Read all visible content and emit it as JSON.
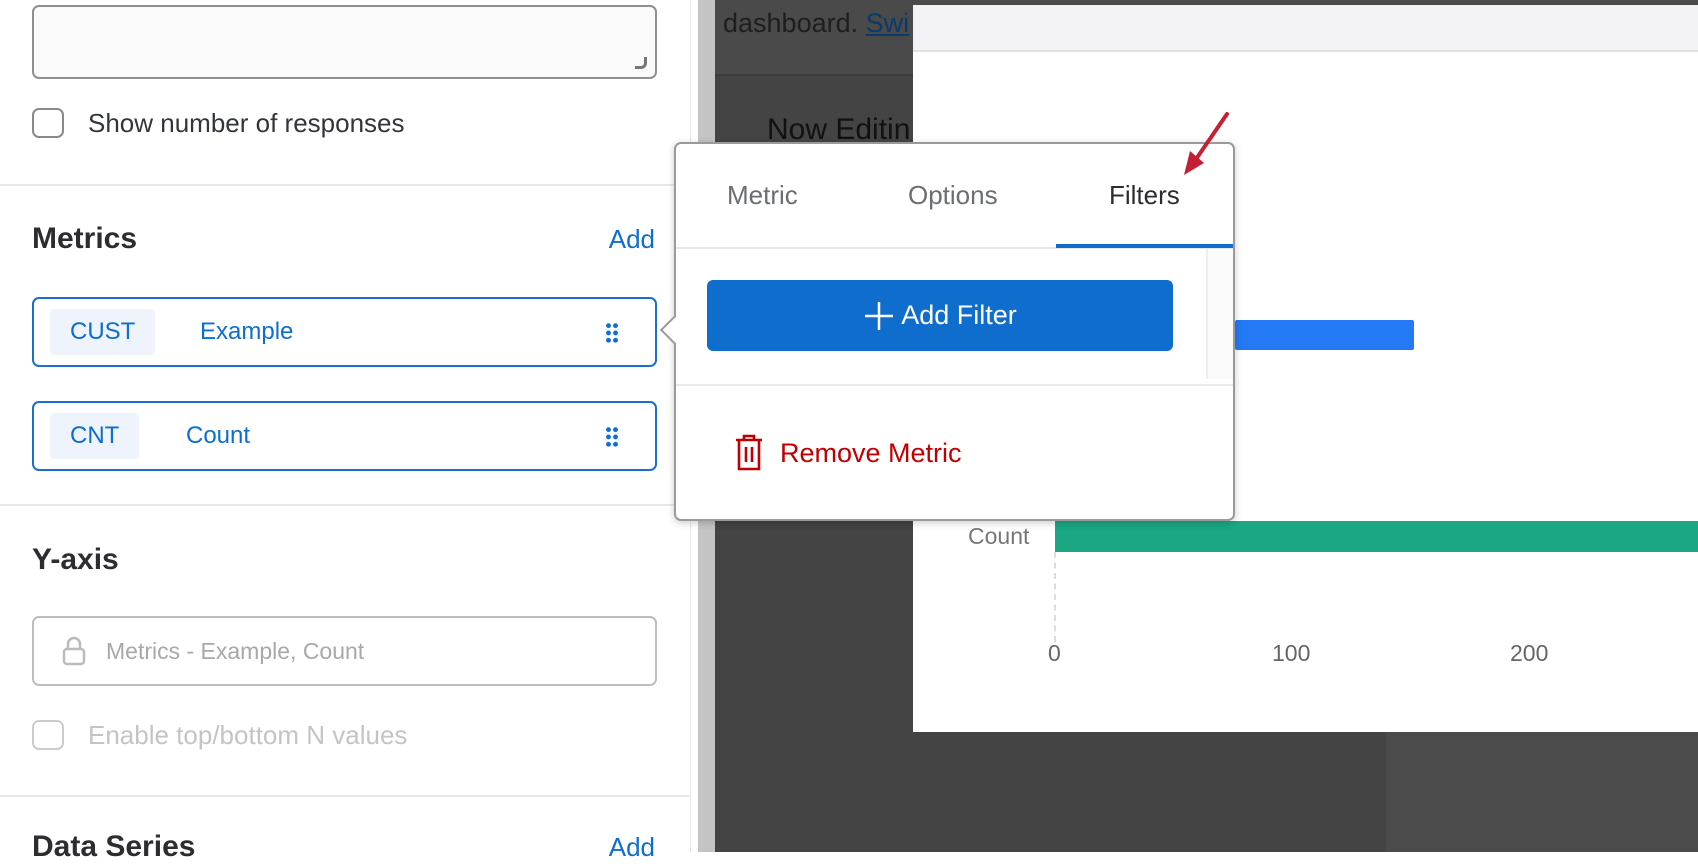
{
  "left_panel": {
    "show_responses_label": "Show number of responses",
    "metrics": {
      "title": "Metrics",
      "add_label": "Add",
      "items": [
        {
          "code": "CUST",
          "name": "Example"
        },
        {
          "code": "CNT",
          "name": "Count"
        }
      ]
    },
    "y_axis": {
      "title": "Y-axis",
      "locked_value": "Metrics - Example, Count",
      "enable_topn_label": "Enable top/bottom N values"
    },
    "data_series": {
      "title": "Data Series",
      "add_label": "Add"
    }
  },
  "background": {
    "dashboard_text": "dashboard.",
    "switch_link": "Swi",
    "now_editing": "Now Editin"
  },
  "chart": {
    "bar_label": "Count",
    "ticks": [
      "0",
      "100",
      "200"
    ],
    "colors": {
      "example": "#2479f5",
      "count": "#1aa782"
    }
  },
  "popover": {
    "tabs": [
      "Metric",
      "Options",
      "Filters"
    ],
    "active_tab": "Filters",
    "add_filter_label": "Add Filter",
    "remove_metric_label": "Remove Metric"
  }
}
